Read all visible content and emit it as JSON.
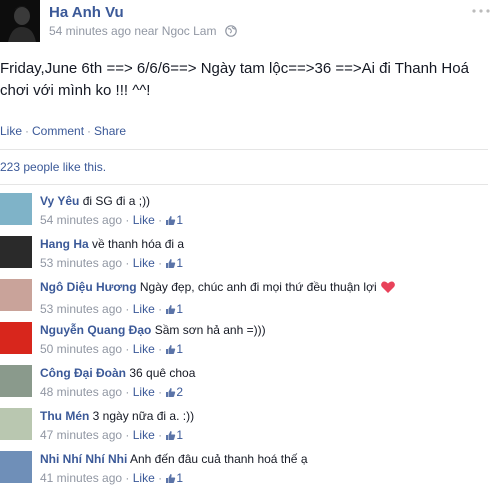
{
  "post": {
    "author": "Ha Anh Vu",
    "time": "54 minutes ago",
    "near_label": "near",
    "location": "Ngoc Lam",
    "text": "Friday,June 6th ==> 6/6/6==> Ngày tam lộc==>36 ==>Ai đi Thanh Hoá chơi với mình ko !!! ^^!"
  },
  "actions": {
    "like": "Like",
    "comment": "Comment",
    "share": "Share",
    "separator": "·"
  },
  "likes_summary": "223 people like this.",
  "comments": [
    {
      "author": "Vy Yêu",
      "text": "đi SG đi a ;))",
      "time": "54 minutes ago",
      "like": "Like",
      "likes": "1",
      "avatar_color": "#7fb3c8"
    },
    {
      "author": "Hang Ha",
      "text": "về thanh hóa đi a",
      "time": "53 minutes ago",
      "like": "Like",
      "likes": "1",
      "avatar_color": "#2a2a2a"
    },
    {
      "author": "Ngô Diệu Hương",
      "text": "Ngày đẹp, chúc anh đi mọi thứ đều thuận lợi",
      "time": "53 minutes ago",
      "like": "Like",
      "likes": "1",
      "avatar_color": "#c9a39a",
      "heart_icon": "heart-emoticon-icon"
    },
    {
      "author": "Nguyễn Quang Đạo",
      "text": "Sầm sơn hả anh =)))",
      "time": "50 minutes ago",
      "like": "Like",
      "likes": "1",
      "avatar_color": "#d8261c"
    },
    {
      "author": "Công Đại Đoàn",
      "text": "36 quê choa",
      "time": "48 minutes ago",
      "like": "Like",
      "likes": "2",
      "avatar_color": "#8a9a8c"
    },
    {
      "author": "Thu Mén",
      "text": "3 ngày nữa đi a. :))",
      "time": "47 minutes ago",
      "like": "Like",
      "likes": "1",
      "avatar_color": "#b9c7b0"
    },
    {
      "author": "Nhi Nhí Nhí Nhi",
      "text": "Anh đến đâu cuả thanh hoá thế ạ",
      "time": "41 minutes ago",
      "like": "Like",
      "likes": "1",
      "avatar_color": "#6f8fb8"
    }
  ],
  "colors": {
    "link": "#3b5998",
    "meta": "#9197a3",
    "text": "#141823",
    "heart": "#e8425a"
  }
}
